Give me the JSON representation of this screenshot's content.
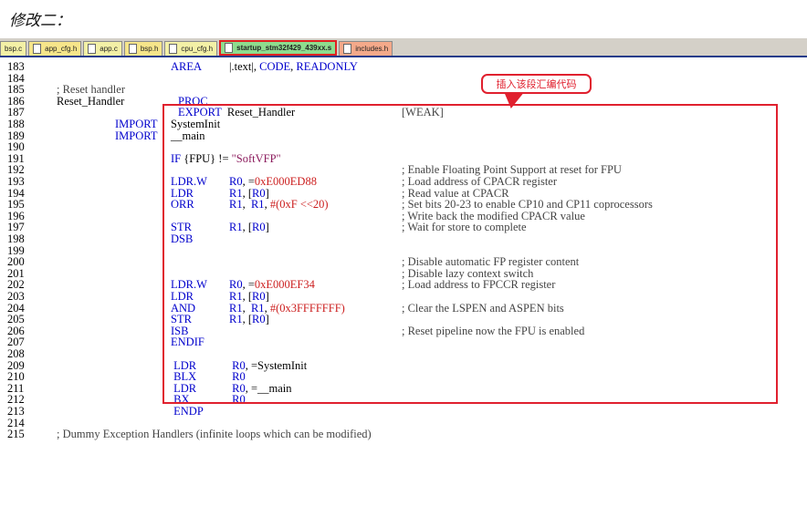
{
  "heading": "修改二：",
  "tabs": [
    {
      "label": "bsp.c",
      "icon": "file-icon"
    },
    {
      "label": "app_cfg.h",
      "icon": "file-icon"
    },
    {
      "label": "app.c",
      "icon": "file-icon"
    },
    {
      "label": "bsp.h",
      "icon": "file-icon"
    },
    {
      "label": "cpu_cfg.h",
      "icon": "file-icon"
    },
    {
      "label": "startup_stm32f429_439xx.s",
      "icon": "file-icon",
      "active": true
    },
    {
      "label": "includes.h",
      "icon": "file-icon"
    }
  ],
  "callout": "插入该段汇编代码",
  "colors": {
    "keyword": "#0000cc",
    "number": "#cc1f1f",
    "highlight": "#e0202e",
    "active_tab": "#8edc8e"
  },
  "lines": [
    {
      "n": "183",
      "c1": "",
      "c2": "AREA",
      "c3": "|.text|, CODE, READONLY",
      "c4": ""
    },
    {
      "n": "184",
      "c1": "",
      "c2": "",
      "c3": "",
      "c4": ""
    },
    {
      "n": "185",
      "c1": "; Reset handler",
      "c2": "",
      "c3": "",
      "c4": ""
    },
    {
      "n": "186",
      "c1": "Reset_Handler",
      "c2": "PROC",
      "c3": "",
      "c4": ""
    },
    {
      "n": "187",
      "c1": "",
      "c2": "EXPORT  Reset_Handler",
      "c3": "",
      "c4": "[WEAK]"
    },
    {
      "n": "188",
      "c1": "IMPORT",
      "c2": "SystemInit",
      "c3": "",
      "c4": ""
    },
    {
      "n": "189",
      "c1": "IMPORT",
      "c2": "__main",
      "c3": "",
      "c4": ""
    },
    {
      "n": "190",
      "c1": "",
      "c2": "",
      "c3": "",
      "c4": ""
    },
    {
      "n": "191",
      "c1": "",
      "c2": "IF {FPU} != \"SoftVFP\"",
      "c3": "",
      "c4": ""
    },
    {
      "n": "192",
      "c1": "",
      "c2": "",
      "c3": "",
      "c4": "; Enable Floating Point Support at reset for FPU"
    },
    {
      "n": "193",
      "c1": "",
      "c2": "LDR.W",
      "c3": "R0, =0xE000ED88",
      "c4": "; Load address of CPACR register"
    },
    {
      "n": "194",
      "c1": "",
      "c2": "LDR",
      "c3": "R1, [R0]",
      "c4": "; Read value at CPACR"
    },
    {
      "n": "195",
      "c1": "",
      "c2": "ORR",
      "c3": "R1,  R1, #(0xF <<20)",
      "c4": "; Set bits 20-23 to enable CP10 and CP11 coprocessors"
    },
    {
      "n": "196",
      "c1": "",
      "c2": "",
      "c3": "",
      "c4": "; Write back the modified CPACR value"
    },
    {
      "n": "197",
      "c1": "",
      "c2": "STR",
      "c3": "R1, [R0]",
      "c4": "; Wait for store to complete"
    },
    {
      "n": "198",
      "c1": "",
      "c2": "DSB",
      "c3": "",
      "c4": ""
    },
    {
      "n": "199",
      "c1": "",
      "c2": "",
      "c3": "",
      "c4": ""
    },
    {
      "n": "200",
      "c1": "",
      "c2": "",
      "c3": "",
      "c4": "; Disable automatic FP register content"
    },
    {
      "n": "201",
      "c1": "",
      "c2": "",
      "c3": "",
      "c4": "; Disable lazy context switch"
    },
    {
      "n": "202",
      "c1": "",
      "c2": "LDR.W",
      "c3": "R0, =0xE000EF34",
      "c4": "; Load address to FPCCR register"
    },
    {
      "n": "203",
      "c1": "",
      "c2": "LDR",
      "c3": "R1, [R0]",
      "c4": ""
    },
    {
      "n": "204",
      "c1": "",
      "c2": "AND",
      "c3": "R1,  R1, #(0x3FFFFFFF)",
      "c4": "; Clear the LSPEN and ASPEN bits"
    },
    {
      "n": "205",
      "c1": "",
      "c2": "STR",
      "c3": "R1, [R0]",
      "c4": ""
    },
    {
      "n": "206",
      "c1": "",
      "c2": "ISB",
      "c3": "",
      "c4": "; Reset pipeline now the FPU is enabled"
    },
    {
      "n": "207",
      "c1": "",
      "c2": "ENDIF",
      "c3": "",
      "c4": ""
    },
    {
      "n": "208",
      "c1": "",
      "c2": "",
      "c3": "",
      "c4": ""
    },
    {
      "n": "209",
      "c1": "",
      "c2": " LDR",
      "c3": " R0, =SystemInit",
      "c4": ""
    },
    {
      "n": "210",
      "c1": "",
      "c2": " BLX",
      "c3": " R0",
      "c4": ""
    },
    {
      "n": "211",
      "c1": "",
      "c2": " LDR",
      "c3": " R0, =__main",
      "c4": ""
    },
    {
      "n": "212",
      "c1": "",
      "c2": " BX",
      "c3": " R0",
      "c4": ""
    },
    {
      "n": "213",
      "c1": "",
      "c2": " ENDP",
      "c3": "",
      "c4": ""
    },
    {
      "n": "214",
      "c1": "",
      "c2": "",
      "c3": "",
      "c4": ""
    },
    {
      "n": "215",
      "c1": "; Dummy Exception Handlers (infinite loops which can be modified)",
      "c2": "",
      "c3": "",
      "c4": ""
    }
  ]
}
